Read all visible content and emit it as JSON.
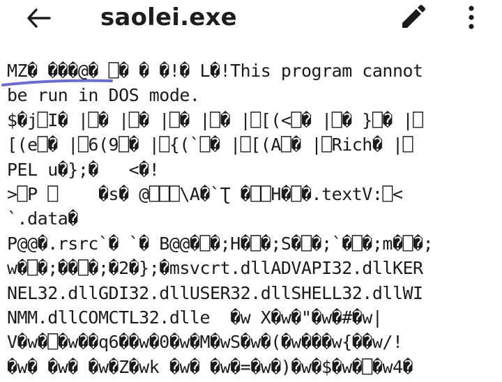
{
  "appbar": {
    "title": "saolei.exe",
    "back_icon": "arrow-left-icon",
    "edit_icon": "pencil-icon",
    "more_icon": "more-vert-icon"
  },
  "file_content": {
    "lines": [
      "MZ� ���@� ⎕� � �!� L�!This program cannot",
      "be run in DOS mode.",
      "$�j⎕I� |⎕� |⎕� |⎕� |⎕� |⎕[(<⎕� |⎕� }⎕� |⎕",
      "[(e⎕� |⎕6(9⎕� |⎕{(`⎕� |⎕[(A⎕� |⎕Rich� |⎕",
      "PEL u�};�   <�!",
      ">⎕P ⎕    �s� @⎕⎕⎕\\A�`Ʈ �⎕⎕H�⎕�.textV:⎕<",
      "`.data�",
      "P@@�.rsrc`� `� B@@�⎕�;H�⎕�;S�⎕�;`�⎕�;m�⎕�;",
      "w�⎕�;��⎕�;�2�};�msvcrt.dllADVAPI32.dllKER",
      "NEL32.dllGDI32.dllUSER32.dllSHELL32.dllWI",
      "NMM.dllCOMCTL32.dlle  �w X�w�\"�w�#�w|",
      "V�w�⎕�w��q6��w�0�w�M�wS�w�(�w���w{��w/!",
      "�w� �w� �w�Z�wk �w� �w�=�w�)�w�$�w�⎕�w4�"
    ],
    "selection_color": "#6a6ad8"
  }
}
